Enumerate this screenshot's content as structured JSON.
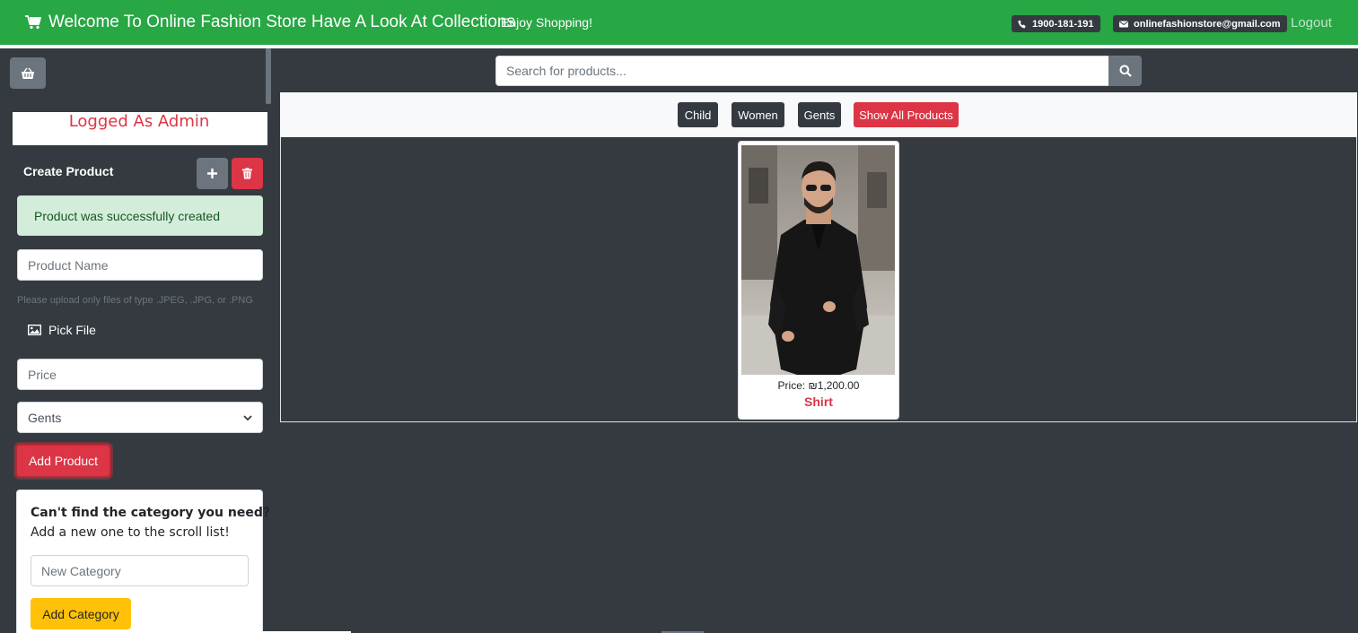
{
  "header": {
    "title": "Welcome To Online Fashion Store Have A Look At Collections",
    "tagline": "Enjoy Shopping!",
    "phone": "1900-181-191",
    "email": "onlinefashionstore@gmail.com",
    "logout_label": "Logout",
    "brand_icon": "shopping-cart-icon",
    "bg_color": "#28a745"
  },
  "sidebar": {
    "basket_icon": "basket-icon",
    "admin_title": "Logged As Admin",
    "create_title": "Create Product",
    "alert_text": "Product was successfully created",
    "product_name_placeholder": "Product Name",
    "upload_hint": "Please upload only files of type .JPEG, .JPG, or .PNG",
    "pick_file_label": "Pick File",
    "price_placeholder": "Price",
    "category_selected": "Gents",
    "add_product_label": "Add Product",
    "category_card": {
      "question": "Can't find the category you need?",
      "subtitle": "Add a new one to the scroll list!",
      "new_category_placeholder": "New Category",
      "add_category_label": "Add Category"
    }
  },
  "main": {
    "search_placeholder": "Search for products...",
    "filters": {
      "child": "Child",
      "women": "Women",
      "gents": "Gents",
      "all": "Show All Products"
    },
    "products": [
      {
        "price": "Price: ₪1,200.00",
        "name": "Shirt"
      }
    ]
  },
  "colors": {
    "danger": "#dc3545",
    "warning": "#ffc107",
    "dark": "#343a40",
    "secondary": "#6c757d",
    "success_bg": "#d4edda"
  }
}
